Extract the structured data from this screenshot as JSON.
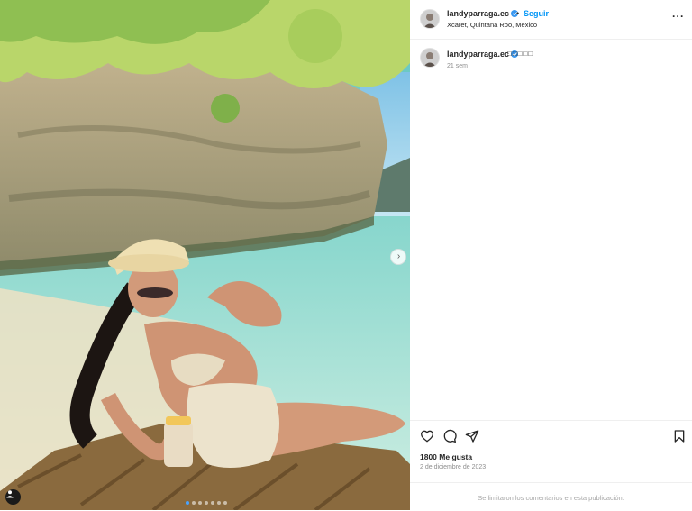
{
  "post": {
    "username": "landyparraga.ec",
    "follow_label": "Seguir",
    "separator": "•",
    "location": "Xcaret, Quintana Roo, Mexico",
    "caption": "□□□□□",
    "caption_time": "21 sem",
    "likes": "1800 Me gusta",
    "date": "2 de diciembre de 2023",
    "comments_disabled": "Se limitaron los comentarios en esta publicación.",
    "more_label": "···",
    "carousel_next": "›"
  },
  "carousel": {
    "total": 7,
    "active": 0
  },
  "icons": {
    "like": "heart-icon",
    "comment": "comment-icon",
    "share": "share-icon",
    "save": "bookmark-icon",
    "more": "more-options-icon",
    "verified": "verified-badge-icon",
    "tag": "user-tag-icon"
  },
  "colors": {
    "accent": "#0095f6",
    "verified": "#3897f0",
    "muted": "#8e8e8e"
  }
}
